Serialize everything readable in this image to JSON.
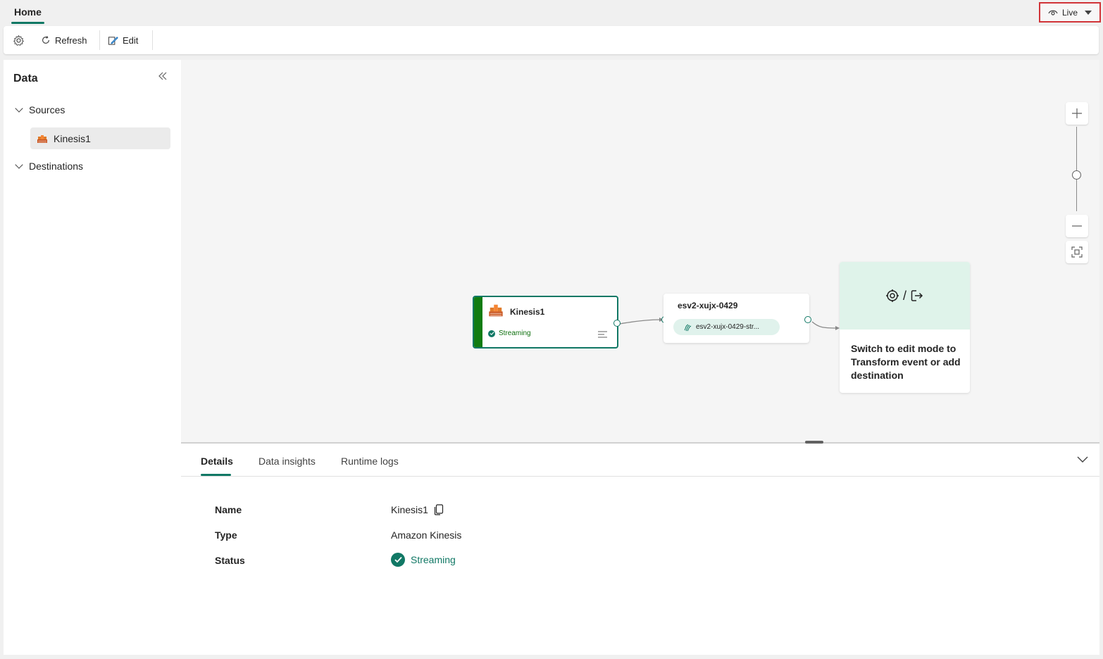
{
  "tabbar": {
    "home_label": "Home",
    "mode_label": "Live"
  },
  "toolbar": {
    "refresh_label": "Refresh",
    "edit_label": "Edit"
  },
  "sidebar": {
    "title": "Data",
    "sources_label": "Sources",
    "source_items": [
      {
        "label": "Kinesis1"
      }
    ],
    "destinations_label": "Destinations"
  },
  "canvas": {
    "source_node": {
      "title": "Kinesis1",
      "status": "Streaming"
    },
    "stream_node": {
      "title": "esv2-xujx-0429",
      "pill_label": "esv2-xujx-0429-str..."
    },
    "hint_node": {
      "icons_sep": "/",
      "text": "Switch to edit mode to Transform event or add destination"
    }
  },
  "details": {
    "tabs": [
      "Details",
      "Data insights",
      "Runtime logs"
    ],
    "name_label": "Name",
    "name_value": "Kinesis1",
    "type_label": "Type",
    "type_value": "Amazon Kinesis",
    "status_label": "Status",
    "status_value": "Streaming"
  },
  "colors": {
    "accent": "#117865",
    "live_outline": "#d13438",
    "source_bar": "#107c10"
  }
}
